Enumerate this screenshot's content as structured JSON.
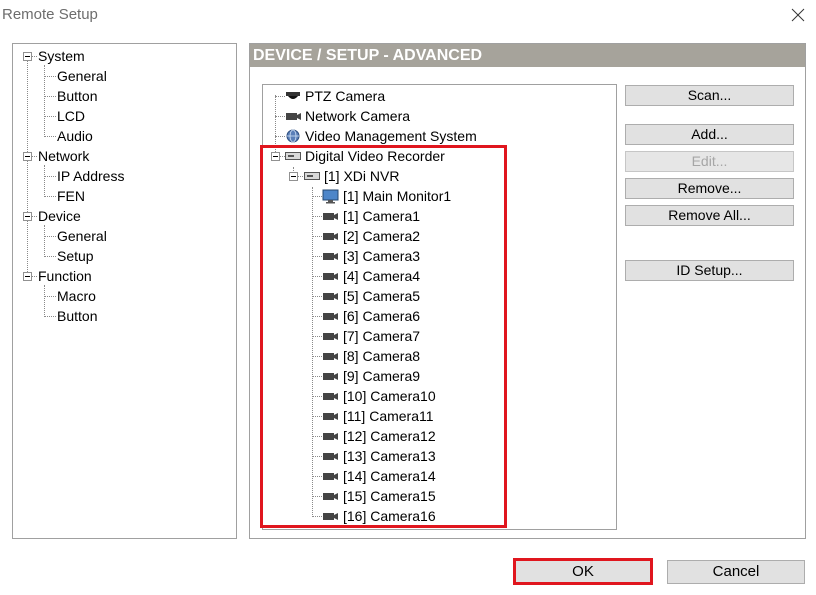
{
  "window": {
    "title": "Remote Setup"
  },
  "nav_tree": [
    {
      "label": "System",
      "children": [
        "General",
        "Button",
        "LCD",
        "Audio"
      ]
    },
    {
      "label": "Network",
      "children": [
        "IP Address",
        "FEN"
      ]
    },
    {
      "label": "Device",
      "children": [
        "General",
        "Setup"
      ]
    },
    {
      "label": "Function",
      "children": [
        "Macro",
        "Button"
      ]
    }
  ],
  "selected_nav": "Device > Setup",
  "panel": {
    "header": "DEVICE / SETUP - ADVANCED"
  },
  "device_tree": {
    "top_items": [
      {
        "label": "PTZ Camera",
        "icon": "ptz-camera-icon"
      },
      {
        "label": "Network Camera",
        "icon": "network-camera-icon"
      },
      {
        "label": "Video Management System",
        "icon": "globe-icon"
      }
    ],
    "dvr": {
      "label": "Digital Video Recorder",
      "icon": "dvr-icon"
    },
    "nvr": {
      "label": "[1] XDi NVR",
      "icon": "dvr-icon"
    },
    "monitor": {
      "label": "[1] Main Monitor1",
      "icon": "monitor-icon"
    },
    "cameras": [
      "[1] Camera1",
      "[2] Camera2",
      "[3] Camera3",
      "[4] Camera4",
      "[5] Camera5",
      "[6] Camera6",
      "[7] Camera7",
      "[8] Camera8",
      "[9] Camera9",
      "[10] Camera10",
      "[11] Camera11",
      "[12] Camera12",
      "[13] Camera13",
      "[14] Camera14",
      "[15] Camera15",
      "[16] Camera16"
    ]
  },
  "buttons": {
    "scan": "Scan...",
    "add": "Add...",
    "edit": "Edit...",
    "remove": "Remove...",
    "remove_all": "Remove All...",
    "id_setup": "ID Setup...",
    "ok": "OK",
    "cancel": "Cancel"
  },
  "colors": {
    "header_bg": "#a6a39b",
    "highlight": "#e0161e",
    "button_bg": "#e1e1e1"
  }
}
